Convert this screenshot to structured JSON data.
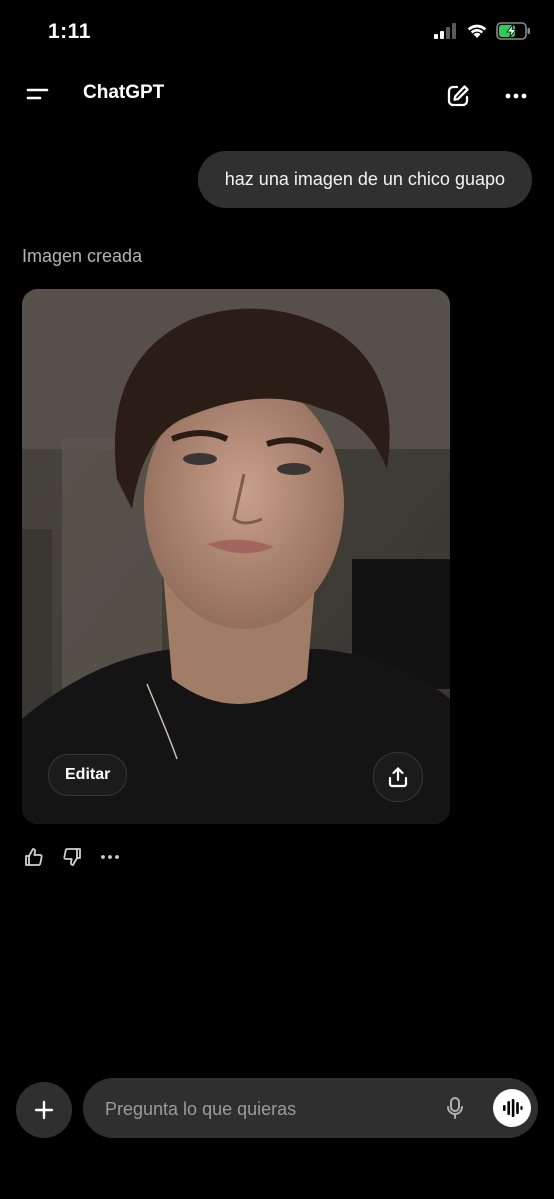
{
  "status_bar": {
    "time": "1:11",
    "icons": [
      "cellular-signal-icon",
      "wifi-icon",
      "battery-charging-icon"
    ]
  },
  "header": {
    "title": "ChatGPT",
    "left_icon": "sidebar-menu-icon",
    "right_icons": [
      "new-chat-icon",
      "more-icon"
    ]
  },
  "conversation": {
    "user_message": "haz una imagen de un chico guapo",
    "assistant_status": "Imagen creada",
    "image_actions": {
      "edit_label": "Editar",
      "share_icon": "share-icon"
    },
    "reactions": [
      "thumbs-up-icon",
      "thumbs-down-icon",
      "more-icon"
    ]
  },
  "composer": {
    "placeholder": "Pregunta lo que quieras",
    "plus_icon": "plus-icon",
    "mic_icon": "microphone-icon",
    "voice_icon": "voice-mode-icon"
  },
  "colors": {
    "background": "#000000",
    "bubble": "#303030",
    "composer": "#2f2f2f",
    "battery_green": "#34c759"
  }
}
